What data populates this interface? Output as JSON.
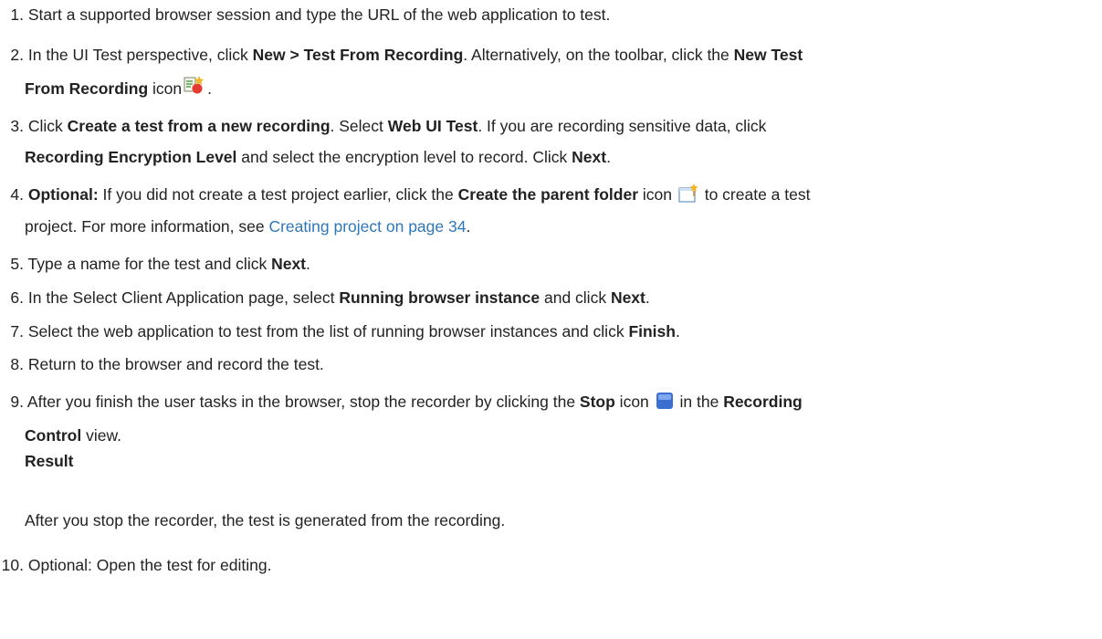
{
  "steps": [
    {
      "num": "1.",
      "text": "Start a supported browser session and type the URL of the web application to test."
    },
    {
      "num": "2.",
      "a": "In the UI Test perspective, click ",
      "b1": "New > Test From Recording",
      "c": ". Alternatively, on the toolbar, click the ",
      "b2": "New Test",
      "b3": "From Recording",
      "d": " icon",
      "e": ".",
      "icon": "new-test-from-recording-icon"
    },
    {
      "num": "3.",
      "a": "Click ",
      "b1": "Create a test from a new recording",
      "c": ". Select ",
      "b2": "Web UI Test",
      "d": ". If you are recording sensitive data, click",
      "b3": "Recording Encryption Level",
      "e": " and select the encryption level to record. Click ",
      "b4": "Next",
      "f": "."
    },
    {
      "num": "4.",
      "b1": "Optional:",
      "a": "  If you did not create a test project earlier, click the ",
      "b2": "Create the parent folder",
      "c": " icon ",
      "d": " to create a test",
      "e": "project. For more information, see ",
      "link": "Creating project on page 34",
      "f": ".",
      "icon": "create-parent-folder-icon"
    },
    {
      "num": "5.",
      "a": "Type a name for the test and click ",
      "b1": "Next",
      "c": "."
    },
    {
      "num": "6.",
      "a": "In the Select Client Application page, select ",
      "b1": "Running browser instance",
      "c": " and click ",
      "b2": "Next",
      "d": "."
    },
    {
      "num": "7.",
      "a": "Select the web application to test from the list of running browser instances and click ",
      "b1": "Finish",
      "c": "."
    },
    {
      "num": "8.",
      "text": "Return to the browser and record the test."
    },
    {
      "num": "9.",
      "a": "After you finish the user tasks in the browser, stop the recorder by clicking the  ",
      "b1": "Stop",
      "c": "  icon ",
      "d": " in the ",
      "b2": "Recording",
      "b3": "Control",
      "e": " view.",
      "result_label": "Result",
      "result_text": "After you stop the recorder, the test is generated from the recording.",
      "icon": "stop-icon"
    },
    {
      "num": "10.",
      "text": "Optional: Open the test for editing."
    }
  ],
  "colors": {
    "text": "#222222",
    "link": "#2f77b8",
    "stop_icon": "#3b6fd0"
  }
}
